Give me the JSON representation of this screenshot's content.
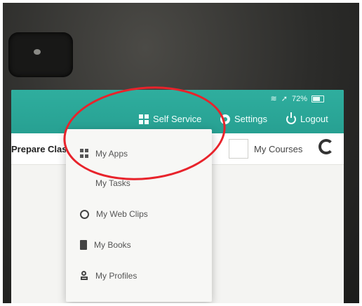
{
  "status": {
    "battery_text": "72%"
  },
  "topbar": {
    "self_service_label": "Self Service",
    "settings_label": "Settings",
    "logout_label": "Logout"
  },
  "subbar": {
    "prepare_label": "Prepare Clas",
    "courses_label": "My Courses"
  },
  "menu": {
    "items": [
      {
        "label": "My Apps",
        "icon": "apps-grid-icon"
      },
      {
        "label": "My Tasks",
        "icon": ""
      },
      {
        "label": "My Web Clips",
        "icon": "globe-icon"
      },
      {
        "label": "My Books",
        "icon": "book-icon"
      },
      {
        "label": "My Profiles",
        "icon": "profile-icon"
      }
    ]
  },
  "colors": {
    "header": "#2aa596",
    "annotation": "#e8232b"
  }
}
